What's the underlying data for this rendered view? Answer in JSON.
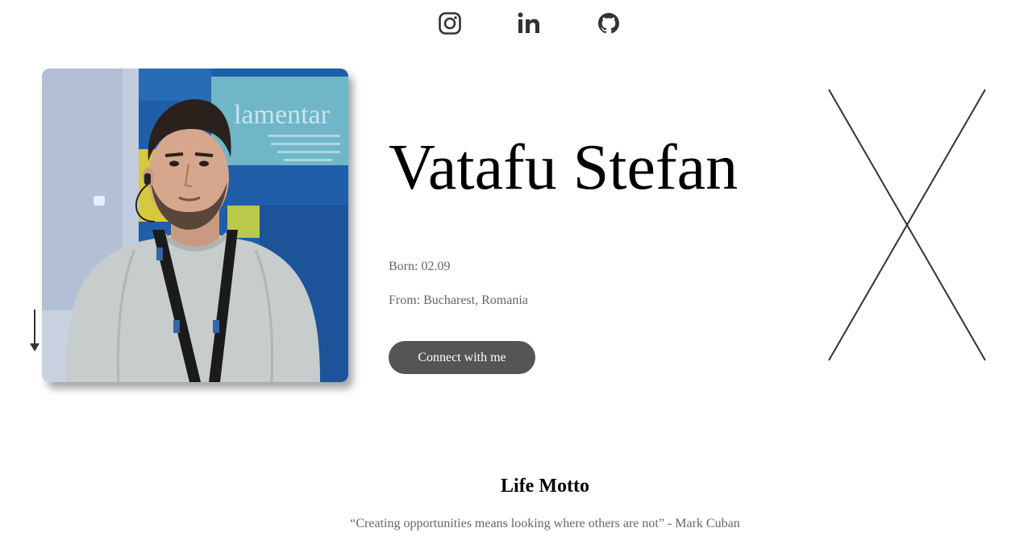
{
  "social": {
    "links": [
      {
        "id": "instagram",
        "icon": "instagram-icon"
      },
      {
        "id": "linkedin",
        "icon": "linkedin-icon"
      },
      {
        "id": "github",
        "icon": "github-icon"
      }
    ],
    "icon_color": "#333333"
  },
  "profile": {
    "name": "Vatafu Stefan",
    "born": "Born: 02.09",
    "from": "From: Bucharest, Romania",
    "connect_label": "Connect with me",
    "photo_alt": "profile-photo"
  },
  "motto": {
    "title": "Life Motto",
    "quote": "“Creating opportunities means looking where others are not” - Mark Cuban"
  },
  "colors": {
    "button_bg": "#555555",
    "button_text": "#ffffff",
    "muted_text": "#666666"
  }
}
